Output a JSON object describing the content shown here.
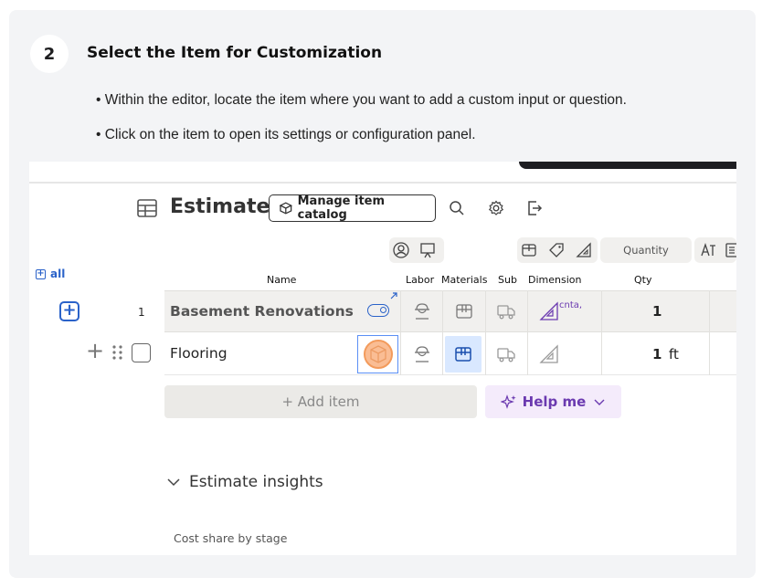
{
  "step": {
    "number": "2",
    "title": "Select the Item for Customization",
    "bullets": [
      "• Within the editor, locate the item where you want to add a custom input or question.",
      "• Click on the item to open its settings or configuration panel."
    ]
  },
  "screenshot": {
    "title": "Estimate",
    "manage_catalog_label": "Manage item catalog",
    "toolbar_icons": [
      "search-icon",
      "gear-icon",
      "export-icon"
    ],
    "quantity_header_pill": "Quantity",
    "all_label": "all",
    "columns": [
      "Name",
      "Labor",
      "Materials",
      "Sub",
      "Dimension",
      "Qty"
    ],
    "rows": [
      {
        "num": "1",
        "name": "Basement Renovations",
        "dimension_note": "cnta,",
        "qty": "1",
        "unit": ""
      },
      {
        "num": "",
        "name": "Flooring",
        "dimension_note": "",
        "qty": "1",
        "unit": "ft"
      }
    ],
    "add_item_label": "+ Add item",
    "help_me_label": "Help me",
    "insights_label": "Estimate insights",
    "cost_share_label": "Cost share by stage",
    "colors": {
      "accent": "#2a62c9",
      "help": "#6b3ab0",
      "highlight": "#f39b5c"
    }
  }
}
